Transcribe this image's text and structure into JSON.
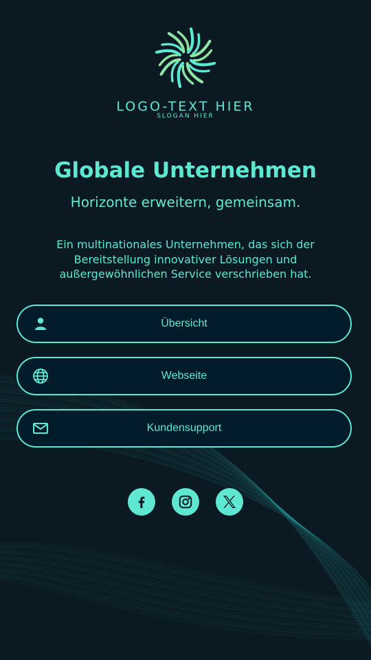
{
  "logo": {
    "text": "LOGO-TEXT HIER",
    "slogan": "SLOGAN HIER"
  },
  "title": "Globale Unternehmen",
  "subtitle": "Horizonte erweitern, gemeinsam.",
  "description": "Ein multinationales Unternehmen, das sich der Bereitstellung innovativer Lösungen und außergewöhnlichen Service verschrieben hat.",
  "buttons": [
    {
      "label": "Übersicht",
      "icon": "user-icon"
    },
    {
      "label": "Webseite",
      "icon": "globe-icon"
    },
    {
      "label": "Kundensupport",
      "icon": "mail-icon"
    }
  ],
  "socials": [
    {
      "icon": "facebook-icon"
    },
    {
      "icon": "instagram-icon"
    },
    {
      "icon": "x-icon"
    }
  ],
  "colors": {
    "background": "#0b1a22",
    "accent": "#5ee8d2",
    "button_fill": "#031c2b",
    "logo_light": "#8fe3a3"
  }
}
